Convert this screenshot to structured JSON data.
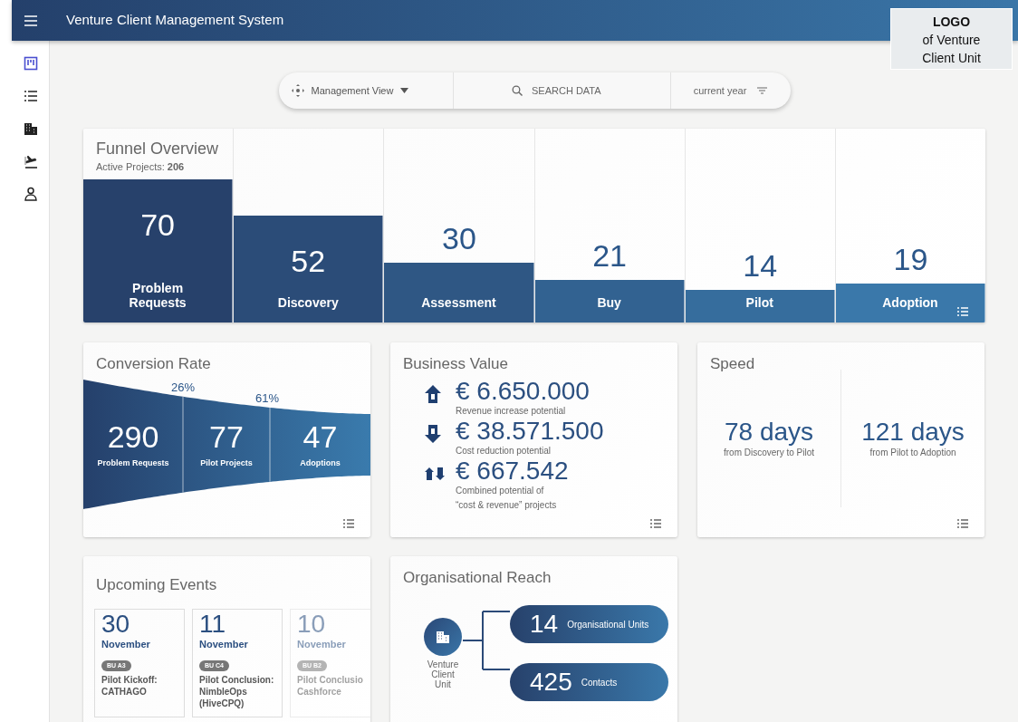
{
  "app_bar": {
    "title": "Venture Client Management System"
  },
  "logo": {
    "title": "LOGO",
    "text": "of Venture\nClient Unit"
  },
  "sidebar": {
    "items": [
      {
        "kind": "board",
        "selected": true
      },
      {
        "kind": "list",
        "selected": false
      },
      {
        "kind": "building",
        "selected": false
      },
      {
        "kind": "plane",
        "selected": false
      },
      {
        "kind": "person",
        "selected": false
      }
    ]
  },
  "toolbar": {
    "view": "Management View",
    "search": {
      "placeholder": "SEARCH DATA"
    },
    "period": "current year"
  },
  "funnel": {
    "title": "Funnel Overview",
    "subtitle": "Active Projects: **206**",
    "stages": [
      {
        "value": "70",
        "label": "Problem\nRequests",
        "level": 0.74
      },
      {
        "value": "52",
        "label": "Discovery",
        "level": 0.55
      },
      {
        "value": "30",
        "label": "Assessment",
        "level": 0.31
      },
      {
        "value": "21",
        "label": "Buy",
        "level": 0.22
      },
      {
        "value": "14",
        "label": "Pilot",
        "level": 0.17
      },
      {
        "value": "19",
        "label": "Adoption",
        "level": 0.2
      }
    ]
  },
  "conversion": {
    "title": "Conversion Rate",
    "steps": [
      {
        "value": "290",
        "label": "Problem Requests"
      },
      {
        "value": "77",
        "label": "Pilot Projects"
      },
      {
        "value": "47",
        "label": "Adoptions"
      }
    ],
    "rates": [
      "26%",
      "61%"
    ]
  },
  "business_value": {
    "title": "Business Value",
    "items": [
      {
        "kind": "increase",
        "amount": "€ 6.650.000",
        "caption": "Revenue increase potential"
      },
      {
        "kind": "reduction",
        "amount": "€ 38.571.500",
        "caption": "Cost reduction potential"
      },
      {
        "kind": "combined",
        "amount": "€ 667.542",
        "caption": "Combined potential of\n“cost & revenue” projects"
      }
    ]
  },
  "speed": {
    "title": "Speed",
    "items": [
      {
        "value": "78 days",
        "caption": "from Discovery to Pilot"
      },
      {
        "value": "121 days",
        "caption": "from Pilot to Adoption"
      }
    ]
  },
  "events": {
    "title": "Upcoming Events",
    "items": [
      {
        "day": "30",
        "month": "November",
        "tag": "BU A3",
        "text": "Pilot Kickoff:\nCATHAGO",
        "faded": false
      },
      {
        "day": "11",
        "month": "November",
        "tag": "BU C4",
        "text": "Pilot Conclusion:\nNimbleOps\n(HiveCPQ)",
        "faded": false
      },
      {
        "day": "10",
        "month": "November",
        "tag": "BU B2",
        "text": "Pilot Conclusio\nCashforce",
        "faded": true
      }
    ]
  },
  "reach": {
    "title": "Organisational Reach",
    "center": "Venture\nClient\nUnit",
    "nodes": [
      {
        "value": "14",
        "label": "Organisational Units"
      },
      {
        "value": "425",
        "label": "Contacts"
      }
    ]
  }
}
